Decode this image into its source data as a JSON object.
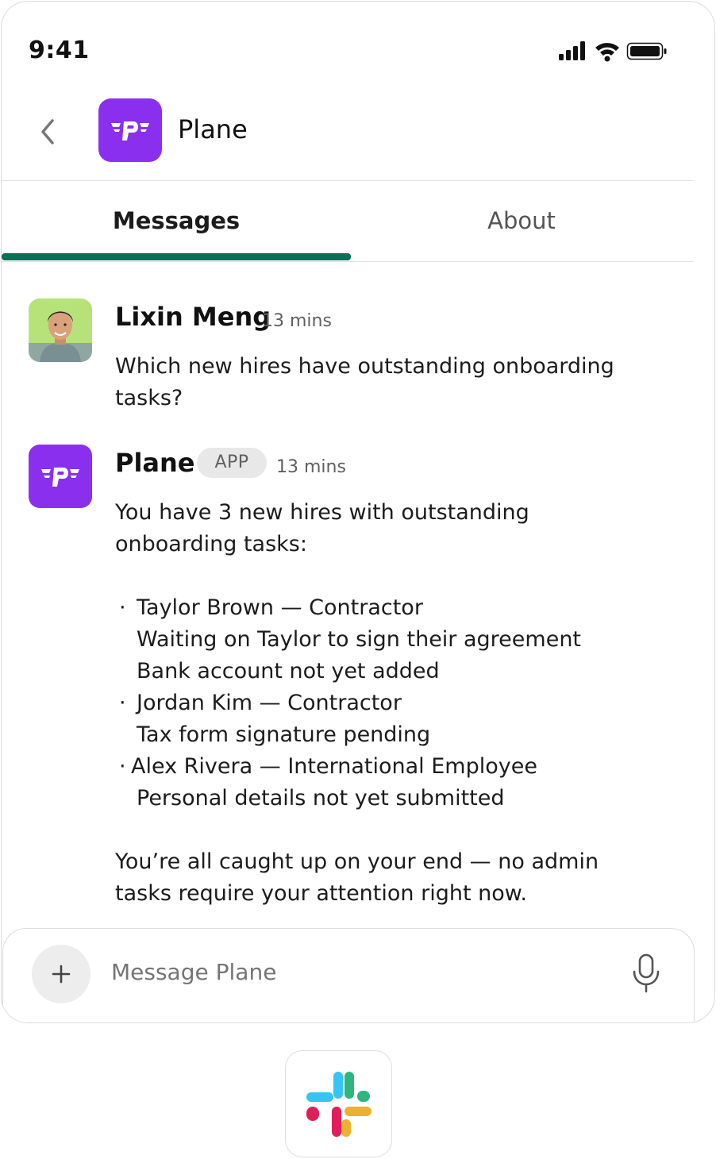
{
  "status_bar": {
    "time": "9:41"
  },
  "header": {
    "title": "Plane"
  },
  "tabs": [
    {
      "label": "Messages",
      "active": true
    },
    {
      "label": "About",
      "active": false
    }
  ],
  "messages": [
    {
      "sender": "Lixin Meng",
      "time": "13 mins",
      "lines": [
        "Which new hires have outstanding onboarding",
        "tasks?"
      ]
    },
    {
      "sender": "Plane",
      "badge": "APP",
      "time": "13 mins",
      "intro": [
        "You have 3 new hires with outstanding",
        "onboarding tasks:"
      ],
      "items": [
        {
          "title": "Taylor Brown — Contractor",
          "details": [
            "Waiting on Taylor to sign their agreement",
            "Bank account not yet added"
          ]
        },
        {
          "title": "Jordan Kim — Contractor",
          "details": [
            "Tax form signature pending"
          ]
        },
        {
          "title": "Alex Rivera — International Employee",
          "details": [
            "Personal details not yet submitted"
          ]
        }
      ],
      "outro": [
        "You’re all caught up on your end — no admin",
        "tasks require your attention right now."
      ]
    }
  ],
  "composer": {
    "placeholder": "Message Plane"
  },
  "colors": {
    "brand": "#8b2fef",
    "tab_underline": "#0b6e55"
  },
  "icons": [
    "back-chevron-icon",
    "signal-icon",
    "wifi-icon",
    "battery-icon",
    "plus-icon",
    "microphone-icon",
    "slack-logo-icon"
  ]
}
